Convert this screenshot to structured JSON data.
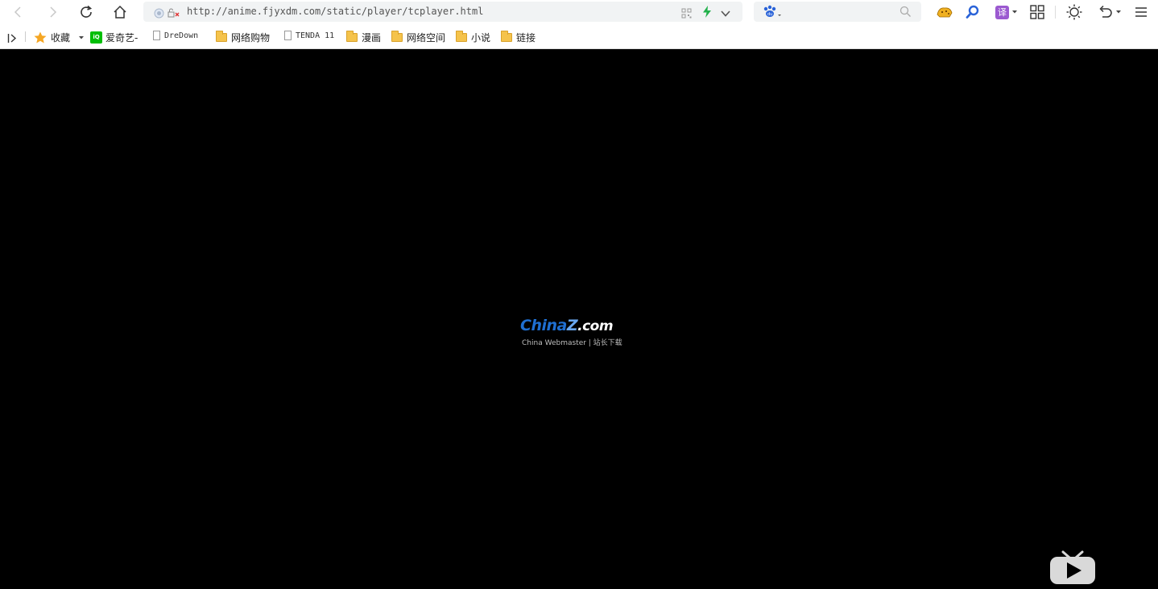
{
  "toolbar": {
    "address_url": "http://anime.fjyxdm.com/static/player/tcplayer.html",
    "translate_label": "译",
    "icons": [
      "back-icon",
      "forward-icon",
      "reload-icon",
      "home-icon",
      "shield-icon",
      "no-tracking-icon",
      "qr-code-icon",
      "lightning-icon",
      "chevron-down-icon",
      "baidu-paw-icon",
      "search-icon",
      "leopard-icon",
      "magnifier-icon",
      "translate-icon",
      "apps-grid-icon",
      "brightness-icon",
      "undo-icon",
      "menu-icon"
    ]
  },
  "bookmarks": {
    "favorites_label": "收藏",
    "items": [
      {
        "label": "爱奇艺-"
      },
      {
        "label": "DreDown"
      },
      {
        "label": "网络购物"
      },
      {
        "label": "TENDA 11"
      },
      {
        "label": "漫画"
      },
      {
        "label": "网络空间"
      },
      {
        "label": "小说"
      },
      {
        "label": "链接"
      }
    ]
  },
  "watermark": {
    "brand_main": "China",
    "brand_z": "Z",
    "brand_com": ".com",
    "tagline": "China Webmaster | 站长下载"
  },
  "colors": {
    "accent_blue": "#1f6fd1",
    "folder_yellow": "#f5c34b",
    "iqiyi_green": "#00be06",
    "translate_purple": "#9b59d0",
    "lightning_green": "#22b14c"
  }
}
